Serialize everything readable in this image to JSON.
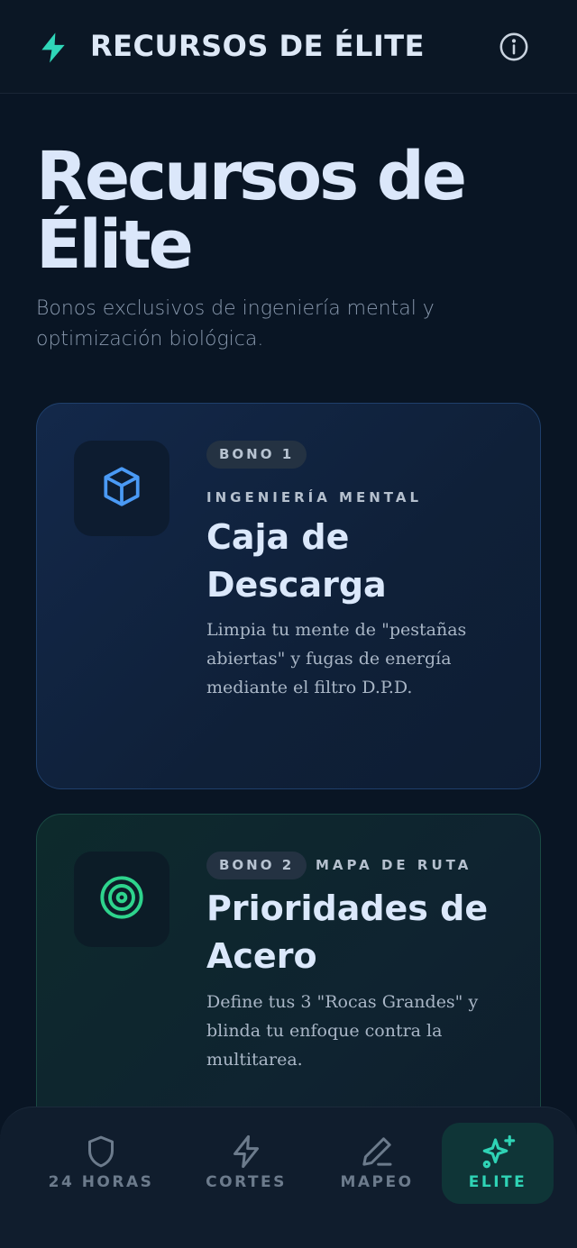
{
  "header": {
    "app_title": "RECURSOS DE ÉLITE",
    "icons": {
      "logo": "bolt-icon",
      "info": "info-icon"
    }
  },
  "main": {
    "title": "Recursos de Élite",
    "subtitle": "Bonos exclusivos de ingeniería mental y optimización biológica."
  },
  "cards": [
    {
      "badge": "BONO 1",
      "category": "INGENIERÍA MENTAL",
      "title": "Caja de Descarga",
      "description": "Limpia tu mente de \"pestañas abiertas\" y fugas de energía mediante el filtro D.P.D.",
      "icon": "cube-icon",
      "accent": "#4a9af5"
    },
    {
      "badge": "BONO 2",
      "category": "MAPA DE RUTA",
      "title": "Prioridades de Acero",
      "description": "Define tus 3 \"Rocas Grandes\" y blinda tu enfoque contra la multitarea.",
      "icon": "target-icon",
      "accent": "#2ed48d"
    }
  ],
  "nav": {
    "items": [
      {
        "label": "24 HORAS",
        "icon": "shield-icon",
        "active": false
      },
      {
        "label": "CORTES",
        "icon": "bolt-icon",
        "active": false
      },
      {
        "label": "MAPEO",
        "icon": "pencil-icon",
        "active": false
      },
      {
        "label": "ELITE",
        "icon": "sparkles-icon",
        "active": true
      }
    ]
  },
  "colors": {
    "background": "#091524",
    "brand_accent": "#2fd3b5",
    "card1_border": "#1f3f6b",
    "card2_border": "#1a4a44"
  }
}
